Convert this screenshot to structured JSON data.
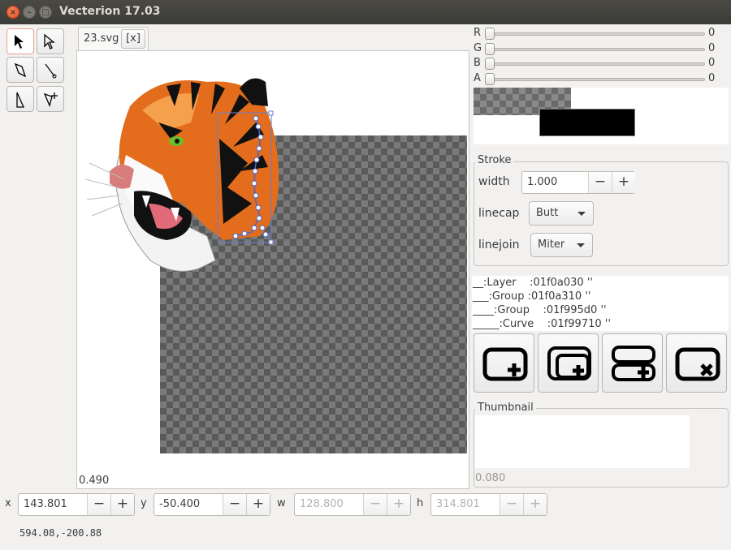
{
  "window": {
    "title": "Vecterion 17.03"
  },
  "document": {
    "tab_name": "23.svg",
    "close_label": "[x]",
    "zoom": "0.490"
  },
  "tools": [
    "select-arrow",
    "node-select-arrow",
    "bezier-pen",
    "line-tool",
    "node-edit",
    "add-node"
  ],
  "color": {
    "channels": [
      {
        "label": "R",
        "value": "0"
      },
      {
        "label": "G",
        "value": "0"
      },
      {
        "label": "B",
        "value": "0"
      },
      {
        "label": "A",
        "value": "0"
      }
    ],
    "stroke_swatch": "#000000"
  },
  "stroke": {
    "title": "Stroke",
    "width_label": "width",
    "width_value": "1.000",
    "linecap_label": "linecap",
    "linecap_value": "Butt",
    "linejoin_label": "linejoin",
    "linejoin_value": "Miter"
  },
  "layers": [
    "__:Layer    :01f0a030 ''",
    "___:Group :01f0a310 ''",
    "____:Group    :01f995d0 ''",
    "_____:Curve    :01f99710 ''"
  ],
  "layer_buttons": [
    "add-layer",
    "add-group",
    "add-stacked-group",
    "delete-element"
  ],
  "thumbnail": {
    "title": "Thumbnail",
    "value": "0.080"
  },
  "geometry": {
    "x_label": "x",
    "x_value": "143.801",
    "y_label": "y",
    "y_value": "-50.400",
    "w_label": "w",
    "w_value": "128.800",
    "h_label": "h",
    "h_value": "314.801"
  },
  "cursor_position": "594.08,-200.88",
  "spin_minus": "−",
  "spin_plus": "+"
}
